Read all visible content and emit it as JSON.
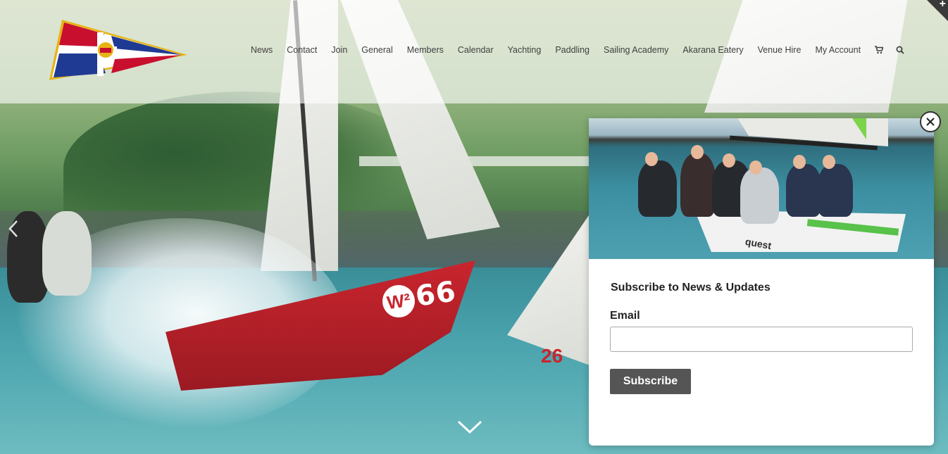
{
  "site": {
    "logo_icon": "club-burgee-icon",
    "brand_colors": {
      "red": "#c8102e",
      "blue": "#1f3a93",
      "gold": "#e7b416",
      "white": "#ffffff"
    }
  },
  "nav": {
    "items": [
      {
        "label": "News"
      },
      {
        "label": "Contact"
      },
      {
        "label": "Join"
      },
      {
        "label": "General"
      },
      {
        "label": "Members"
      },
      {
        "label": "Calendar"
      },
      {
        "label": "Yachting"
      },
      {
        "label": "Paddling"
      },
      {
        "label": "Sailing Academy"
      },
      {
        "label": "Akarana Eatery"
      },
      {
        "label": "Venue Hire"
      },
      {
        "label": "My Account"
      }
    ],
    "cart_icon": "cart-icon",
    "search_icon": "search-icon"
  },
  "hero": {
    "sail_number": "66",
    "sail_logo": "W²",
    "second_boat_number": "26",
    "prev_icon": "chevron-left-icon",
    "scroll_icon": "chevron-down-icon"
  },
  "popup": {
    "image_brand_text": "quest",
    "title": "Subscribe to News & Updates",
    "email_label": "Email",
    "email_value": "",
    "submit_label": "Subscribe",
    "close_icon": "close-icon"
  }
}
